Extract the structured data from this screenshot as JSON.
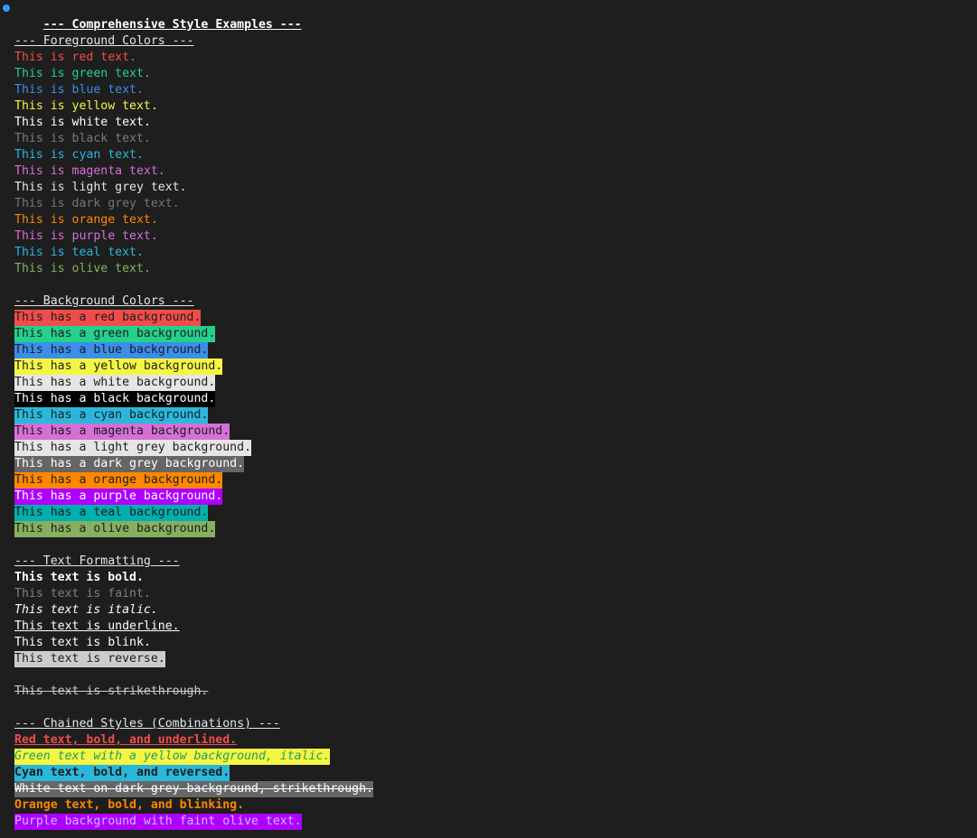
{
  "title": "--- Comprehensive Style Examples ---",
  "colors": {
    "red": "#f14c4c",
    "green": "#23d18b",
    "blue": "#3b8eea",
    "yellow": "#f5f543",
    "white": "#ffffff",
    "black": "#666666",
    "cyan": "#29b8db",
    "magenta": "#d670d6",
    "light_grey": "#e5e5e5",
    "dark_grey": "#767676",
    "orange": "#ff8700",
    "purple": "#af00ff",
    "teal": "#00afaf",
    "olive": "#87af5f"
  },
  "sections": [
    {
      "heading": "--- Foreground Colors ---",
      "lines": [
        {
          "text": "This is red text.",
          "fg": "#f14c4c"
        },
        {
          "text": "This is green text.",
          "fg": "#23d18b"
        },
        {
          "text": "This is blue text.",
          "fg": "#3b8eea"
        },
        {
          "text": "This is yellow text.",
          "fg": "#f5f543"
        },
        {
          "text": "This is white text.",
          "fg": "#ffffff"
        },
        {
          "text": "This is black text.",
          "fg": "#7a7a7a"
        },
        {
          "text": "This is cyan text.",
          "fg": "#29b8db"
        },
        {
          "text": "This is magenta text.",
          "fg": "#d670d6"
        },
        {
          "text": "This is light grey text.",
          "fg": "#e5e5e5"
        },
        {
          "text": "This is dark grey text.",
          "fg": "#767676"
        },
        {
          "text": "This is orange text.",
          "fg": "#ff8700"
        },
        {
          "text": "This is purple text.",
          "fg": "#d670d6"
        },
        {
          "text": "This is teal text.",
          "fg": "#29b8db"
        },
        {
          "text": "This is olive text.",
          "fg": "#87af5f"
        }
      ]
    },
    {
      "heading": "--- Background Colors ---",
      "lines": [
        {
          "text": "This has a red background.",
          "fg": "#1e1e1e",
          "bg": "#f14c4c"
        },
        {
          "text": "This has a green background.",
          "fg": "#1e1e1e",
          "bg": "#23d18b"
        },
        {
          "text": "This has a blue background.",
          "fg": "#1e1e1e",
          "bg": "#3b8eea"
        },
        {
          "text": "This has a yellow background.",
          "fg": "#1e1e1e",
          "bg": "#f5f543"
        },
        {
          "text": "This has a white background.",
          "fg": "#1e1e1e",
          "bg": "#e5e5e5"
        },
        {
          "text": "This has a black background.",
          "fg": "#ffffff",
          "bg": "#000000"
        },
        {
          "text": "This has a cyan background.",
          "fg": "#1e1e1e",
          "bg": "#29b8db"
        },
        {
          "text": "This has a magenta background.",
          "fg": "#1e1e1e",
          "bg": "#d670d6"
        },
        {
          "text": "This has a light grey background.",
          "fg": "#1e1e1e",
          "bg": "#e5e5e5"
        },
        {
          "text": "This has a dark grey background.",
          "fg": "#ffffff",
          "bg": "#666666"
        },
        {
          "text": "This has a orange background.",
          "fg": "#1e1e1e",
          "bg": "#ff8700"
        },
        {
          "text": "This has a purple background.",
          "fg": "#ffffff",
          "bg": "#af00ff"
        },
        {
          "text": "This has a teal background.",
          "fg": "#1e1e1e",
          "bg": "#00afaf"
        },
        {
          "text": "This has a olive background.",
          "fg": "#1e1e1e",
          "bg": "#87af5f"
        }
      ]
    },
    {
      "heading": "--- Text Formatting ---",
      "lines": [
        {
          "text": "This text is bold.",
          "fg": "#ffffff",
          "styles": [
            "bold"
          ]
        },
        {
          "text": "This text is faint.",
          "fg": "#cccccc",
          "styles": [
            "faint"
          ]
        },
        {
          "text": "This text is italic.",
          "fg": "#ffffff",
          "styles": [
            "italic"
          ]
        },
        {
          "text": "This text is underline.",
          "fg": "#ffffff",
          "styles": [
            "underline"
          ]
        },
        {
          "text": "This text is blink.",
          "fg": "#ffffff"
        },
        {
          "text": "This text is reverse.",
          "fg": "#1e1e1e",
          "bg": "#cccccc"
        },
        {
          "text": "",
          "fg": "#cccccc"
        },
        {
          "text": "This text is strikethrough.",
          "fg": "#cccccc",
          "styles": [
            "strike"
          ]
        }
      ]
    },
    {
      "heading": "--- Chained Styles (Combinations) ---",
      "lines": [
        {
          "text": "Red text, bold, and underlined.",
          "fg": "#f14c4c",
          "styles": [
            "bold",
            "underline"
          ]
        },
        {
          "text": "Green text with a yellow background, italic.",
          "fg": "#1e9e60",
          "bg": "#f5f543",
          "styles": [
            "italic"
          ]
        },
        {
          "text": "Cyan text, bold, and reversed.",
          "fg": "#1e1e1e",
          "bg": "#29b8db",
          "styles": [
            "bold"
          ]
        },
        {
          "text": "White text on dark grey background, strikethrough.",
          "fg": "#ffffff",
          "bg": "#666666",
          "styles": [
            "strike"
          ]
        },
        {
          "text": "Orange text, bold, and blinking.",
          "fg": "#ff8700",
          "styles": [
            "bold"
          ]
        },
        {
          "text": "Purple background with faint olive text.",
          "fg": "#87af5f",
          "bg": "#af00ff",
          "styles": [
            "faint-on-bg"
          ]
        }
      ]
    }
  ]
}
